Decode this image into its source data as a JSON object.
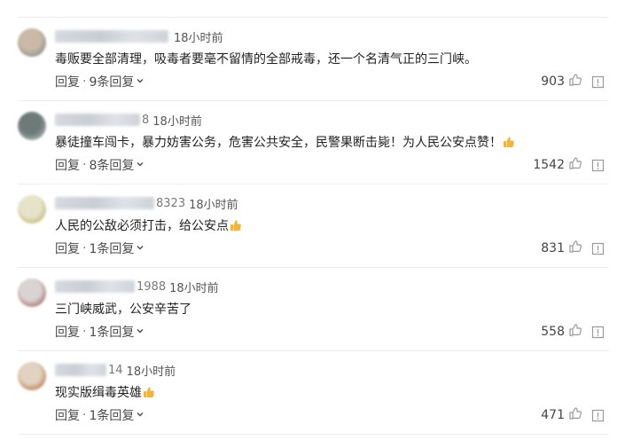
{
  "comments": [
    {
      "name_tail": "",
      "time": "18小时前",
      "text": "毒贩要全部清理，吸毒者要毫不留情的全部戒毒，还一个名清气正的三门峡。",
      "has_emoji": false,
      "reply_label": "回复",
      "replies_label": "9条回复",
      "likes": "903",
      "avatar_colors": [
        "#c9b9a6",
        "#8a8f86"
      ]
    },
    {
      "name_tail": "8",
      "time": "18小时前",
      "text": "暴徒撞车闯卡，暴力妨害公务，危害公共安全，民警果断击毙！为人民公安点赞！",
      "has_emoji": true,
      "reply_label": "回复",
      "replies_label": "8条回复",
      "likes": "1542",
      "avatar_colors": [
        "#6d7a78",
        "#a7b1ac"
      ]
    },
    {
      "name_tail": "8323",
      "time": "18小时前",
      "text": "人民的公敌必须打击，给公安点",
      "has_emoji": true,
      "reply_label": "回复",
      "replies_label": "1条回复",
      "likes": "831",
      "avatar_colors": [
        "#e7e3c9",
        "#c4b77a"
      ]
    },
    {
      "name_tail": "1988",
      "time": "18小时前",
      "text": "三门峡威武，公安辛苦了",
      "has_emoji": false,
      "reply_label": "回复",
      "replies_label": "1条回复",
      "likes": "558",
      "avatar_colors": [
        "#d9d3d3",
        "#a86e6e"
      ]
    },
    {
      "name_tail": "14",
      "time": "18小时前",
      "text": "现实版缉毒英雄",
      "has_emoji": true,
      "reply_label": "回复",
      "replies_label": "1条回复",
      "likes": "471",
      "avatar_colors": [
        "#e1d2c1",
        "#b97a4d"
      ]
    }
  ],
  "icons": {
    "like": "thumbs-up-icon",
    "report": "report-icon",
    "expand": "chevron-down-icon",
    "emoji": "thumbs-up-emoji"
  },
  "colors": {
    "emoji": "#f2b53a",
    "divider": "#ececec"
  }
}
